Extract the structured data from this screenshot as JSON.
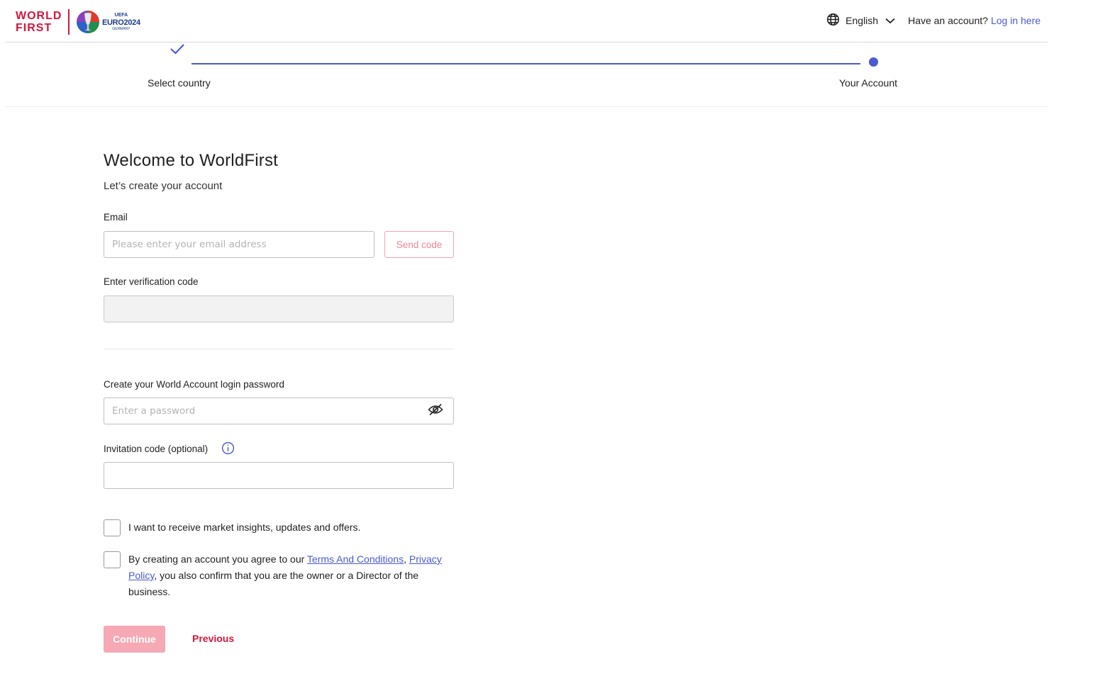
{
  "header": {
    "logo_line1": "WORLD",
    "logo_line2": "FIRST",
    "euro_uefa": "UEFA",
    "euro_name": "EURO2024",
    "euro_country": "GERMANY",
    "language_icon": "globe-icon",
    "language": "English",
    "have_account": "Have an account?",
    "login_link": "Log in here"
  },
  "steps": {
    "items": [
      {
        "label": "Select country",
        "state": "done"
      },
      {
        "label": "Your Account",
        "state": "current"
      }
    ]
  },
  "form": {
    "title": "Welcome to WorldFirst",
    "subtitle": "Let’s create your account",
    "email_label": "Email",
    "email_placeholder": "Please enter your email address",
    "email_value": "",
    "send_code": "Send code",
    "verification_label": "Enter verification code",
    "verification_value": "",
    "password_label": "Create your World Account login password",
    "password_placeholder": "Enter a password",
    "password_value": "",
    "password_toggle_icon": "eye-slash-icon",
    "invitation_label": "Invitation code (optional)",
    "invitation_info_icon": "info-icon",
    "invitation_value": "",
    "marketing_text": "I want to receive market insights, updates and offers.",
    "marketing_checked": false,
    "terms_prefix": "By creating an account you agree to our ",
    "terms_link": "Terms And Conditions",
    "terms_sep": ", ",
    "privacy_link": "Privacy Policy",
    "terms_suffix": ", you also confirm that you are the owner or a Director of the business.",
    "terms_checked": false,
    "continue": "Continue",
    "previous": "Previous"
  },
  "colors": {
    "brand_red": "#d6163d",
    "accent_blue": "#4a5ad0",
    "continue_disabled": "#f6a8b5"
  }
}
